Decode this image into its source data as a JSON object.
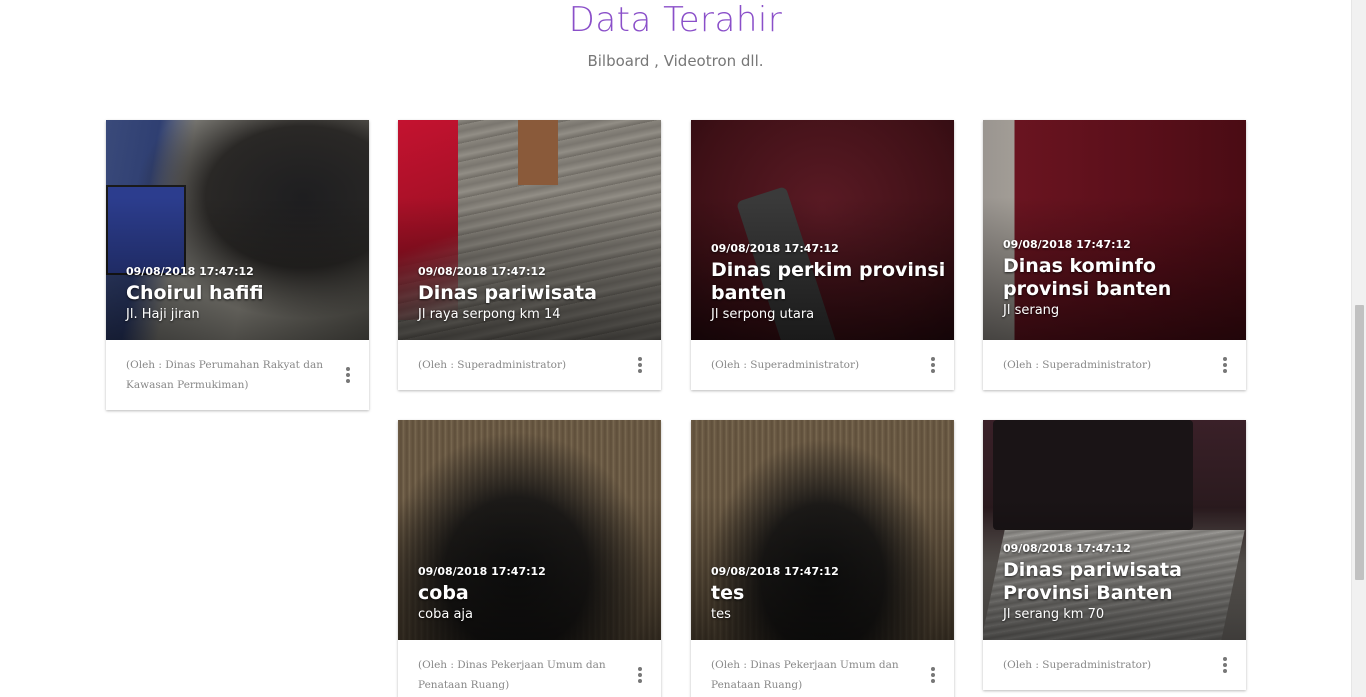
{
  "section": {
    "title": "Data Terahir",
    "subtitle": "Bilboard , Videotron dll."
  },
  "cards": [
    {
      "date": "09/08/2018 17:47:12",
      "title": "Choirul hafifi",
      "address": "Jl. Haji jiran",
      "author": "(Oleh : Dinas Perumahan Rakyat dan Kawasan Permukiman)"
    },
    {
      "date": "09/08/2018 17:47:12",
      "title": "Dinas pariwisata",
      "address": "Jl raya serpong km 14",
      "author": "(Oleh : Superadministrator)"
    },
    {
      "date": "09/08/2018 17:47:12",
      "title": "Dinas perkim provinsi banten",
      "address": "Jl serpong utara",
      "author": "(Oleh : Superadministrator)"
    },
    {
      "date": "09/08/2018 17:47:12",
      "title": "Dinas kominfo provinsi banten",
      "address": "Jl serang",
      "author": "(Oleh : Superadministrator)"
    },
    {
      "date": "09/08/2018 17:47:12",
      "title": "coba",
      "address": "coba aja",
      "author": "(Oleh : Dinas Pekerjaan Umum dan Penataan Ruang)"
    },
    {
      "date": "09/08/2018 17:47:12",
      "title": "tes",
      "address": "tes",
      "author": "(Oleh : Dinas Pekerjaan Umum dan Penataan Ruang)"
    },
    {
      "date": "09/08/2018 17:47:12",
      "title": "Dinas pariwisata Provinsi Banten",
      "address": "Jl serang km 70",
      "author": "(Oleh : Superadministrator)"
    }
  ],
  "colors": {
    "accent": "#8a4fc9"
  },
  "icons": {
    "card_menu": "more-vert-icon"
  }
}
